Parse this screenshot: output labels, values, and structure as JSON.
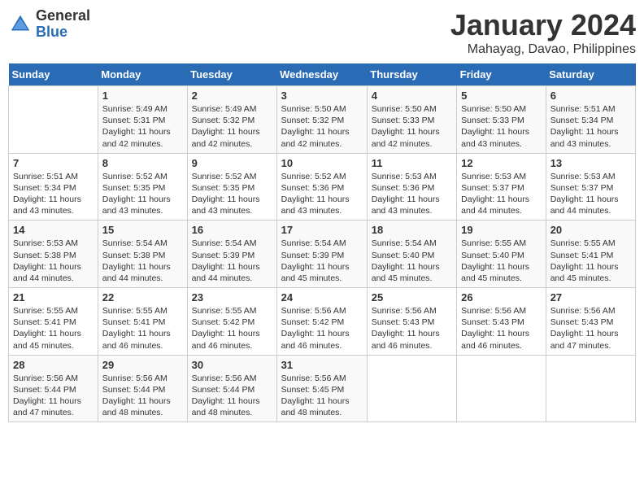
{
  "header": {
    "logo_general": "General",
    "logo_blue": "Blue",
    "title": "January 2024",
    "subtitle": "Mahayag, Davao, Philippines"
  },
  "days_of_week": [
    "Sunday",
    "Monday",
    "Tuesday",
    "Wednesday",
    "Thursday",
    "Friday",
    "Saturday"
  ],
  "weeks": [
    [
      {
        "day": "",
        "info": ""
      },
      {
        "day": "1",
        "info": "Sunrise: 5:49 AM\nSunset: 5:31 PM\nDaylight: 11 hours\nand 42 minutes."
      },
      {
        "day": "2",
        "info": "Sunrise: 5:49 AM\nSunset: 5:32 PM\nDaylight: 11 hours\nand 42 minutes."
      },
      {
        "day": "3",
        "info": "Sunrise: 5:50 AM\nSunset: 5:32 PM\nDaylight: 11 hours\nand 42 minutes."
      },
      {
        "day": "4",
        "info": "Sunrise: 5:50 AM\nSunset: 5:33 PM\nDaylight: 11 hours\nand 42 minutes."
      },
      {
        "day": "5",
        "info": "Sunrise: 5:50 AM\nSunset: 5:33 PM\nDaylight: 11 hours\nand 43 minutes."
      },
      {
        "day": "6",
        "info": "Sunrise: 5:51 AM\nSunset: 5:34 PM\nDaylight: 11 hours\nand 43 minutes."
      }
    ],
    [
      {
        "day": "7",
        "info": "Sunrise: 5:51 AM\nSunset: 5:34 PM\nDaylight: 11 hours\nand 43 minutes."
      },
      {
        "day": "8",
        "info": "Sunrise: 5:52 AM\nSunset: 5:35 PM\nDaylight: 11 hours\nand 43 minutes."
      },
      {
        "day": "9",
        "info": "Sunrise: 5:52 AM\nSunset: 5:35 PM\nDaylight: 11 hours\nand 43 minutes."
      },
      {
        "day": "10",
        "info": "Sunrise: 5:52 AM\nSunset: 5:36 PM\nDaylight: 11 hours\nand 43 minutes."
      },
      {
        "day": "11",
        "info": "Sunrise: 5:53 AM\nSunset: 5:36 PM\nDaylight: 11 hours\nand 43 minutes."
      },
      {
        "day": "12",
        "info": "Sunrise: 5:53 AM\nSunset: 5:37 PM\nDaylight: 11 hours\nand 44 minutes."
      },
      {
        "day": "13",
        "info": "Sunrise: 5:53 AM\nSunset: 5:37 PM\nDaylight: 11 hours\nand 44 minutes."
      }
    ],
    [
      {
        "day": "14",
        "info": "Sunrise: 5:53 AM\nSunset: 5:38 PM\nDaylight: 11 hours\nand 44 minutes."
      },
      {
        "day": "15",
        "info": "Sunrise: 5:54 AM\nSunset: 5:38 PM\nDaylight: 11 hours\nand 44 minutes."
      },
      {
        "day": "16",
        "info": "Sunrise: 5:54 AM\nSunset: 5:39 PM\nDaylight: 11 hours\nand 44 minutes."
      },
      {
        "day": "17",
        "info": "Sunrise: 5:54 AM\nSunset: 5:39 PM\nDaylight: 11 hours\nand 45 minutes."
      },
      {
        "day": "18",
        "info": "Sunrise: 5:54 AM\nSunset: 5:40 PM\nDaylight: 11 hours\nand 45 minutes."
      },
      {
        "day": "19",
        "info": "Sunrise: 5:55 AM\nSunset: 5:40 PM\nDaylight: 11 hours\nand 45 minutes."
      },
      {
        "day": "20",
        "info": "Sunrise: 5:55 AM\nSunset: 5:41 PM\nDaylight: 11 hours\nand 45 minutes."
      }
    ],
    [
      {
        "day": "21",
        "info": "Sunrise: 5:55 AM\nSunset: 5:41 PM\nDaylight: 11 hours\nand 45 minutes."
      },
      {
        "day": "22",
        "info": "Sunrise: 5:55 AM\nSunset: 5:41 PM\nDaylight: 11 hours\nand 46 minutes."
      },
      {
        "day": "23",
        "info": "Sunrise: 5:55 AM\nSunset: 5:42 PM\nDaylight: 11 hours\nand 46 minutes."
      },
      {
        "day": "24",
        "info": "Sunrise: 5:56 AM\nSunset: 5:42 PM\nDaylight: 11 hours\nand 46 minutes."
      },
      {
        "day": "25",
        "info": "Sunrise: 5:56 AM\nSunset: 5:43 PM\nDaylight: 11 hours\nand 46 minutes."
      },
      {
        "day": "26",
        "info": "Sunrise: 5:56 AM\nSunset: 5:43 PM\nDaylight: 11 hours\nand 46 minutes."
      },
      {
        "day": "27",
        "info": "Sunrise: 5:56 AM\nSunset: 5:43 PM\nDaylight: 11 hours\nand 47 minutes."
      }
    ],
    [
      {
        "day": "28",
        "info": "Sunrise: 5:56 AM\nSunset: 5:44 PM\nDaylight: 11 hours\nand 47 minutes."
      },
      {
        "day": "29",
        "info": "Sunrise: 5:56 AM\nSunset: 5:44 PM\nDaylight: 11 hours\nand 48 minutes."
      },
      {
        "day": "30",
        "info": "Sunrise: 5:56 AM\nSunset: 5:44 PM\nDaylight: 11 hours\nand 48 minutes."
      },
      {
        "day": "31",
        "info": "Sunrise: 5:56 AM\nSunset: 5:45 PM\nDaylight: 11 hours\nand 48 minutes."
      },
      {
        "day": "",
        "info": ""
      },
      {
        "day": "",
        "info": ""
      },
      {
        "day": "",
        "info": ""
      }
    ]
  ]
}
